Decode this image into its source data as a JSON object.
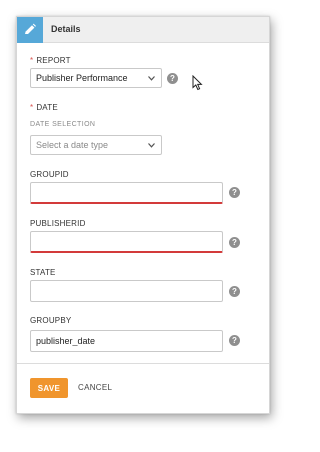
{
  "header": {
    "title": "Details",
    "icon": "pencil-icon"
  },
  "form": {
    "report": {
      "required_mark": "*",
      "label": "REPORT",
      "value": "Publisher Performance"
    },
    "date": {
      "required_mark": "*",
      "label": "DATE",
      "selection_label": "DATE SELECTION",
      "selection_placeholder": "Select a date type"
    },
    "groupid": {
      "label": "GROUPID",
      "value": ""
    },
    "publisherid": {
      "label": "PUBLISHERID",
      "value": ""
    },
    "state": {
      "label": "STATE",
      "value": ""
    },
    "groupby": {
      "label": "GROUPBY",
      "value": "publisher_date"
    },
    "help_glyph": "?"
  },
  "footer": {
    "save_label": "SAVE",
    "cancel_label": "CANCEL"
  },
  "colors": {
    "header_accent": "#56a8d8",
    "save_button": "#f0952d",
    "required": "#d9534f",
    "invalid_underline": "#d33a3a"
  }
}
